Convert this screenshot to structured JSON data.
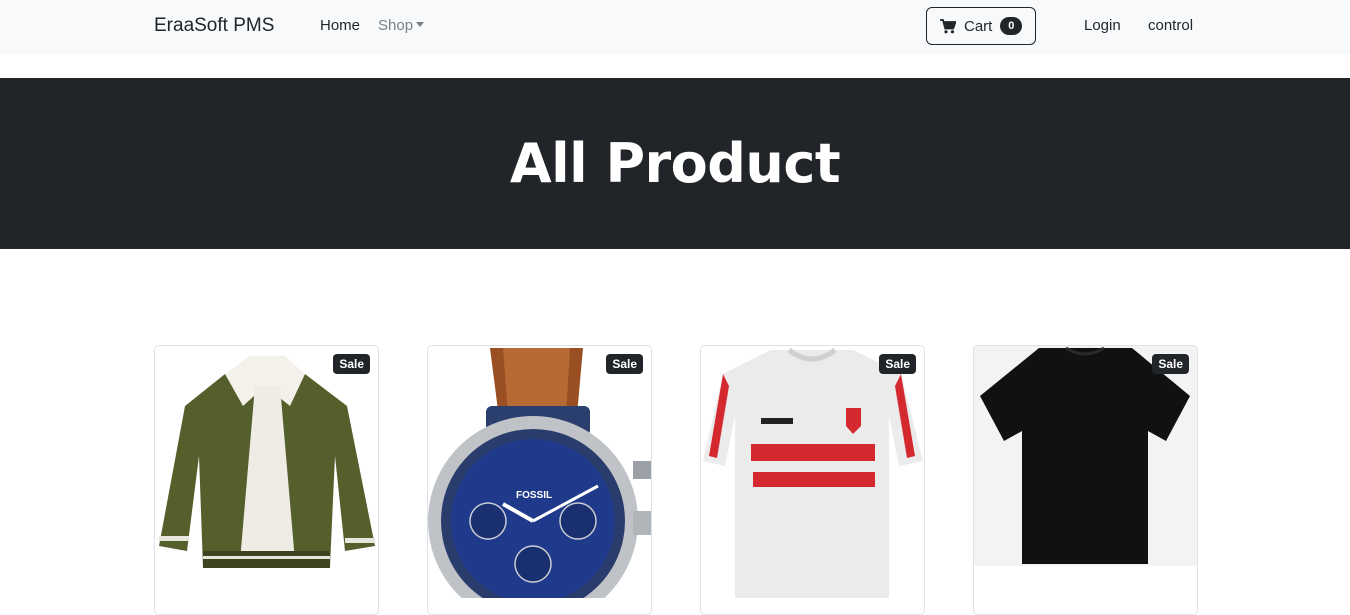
{
  "navbar": {
    "brand": "EraaSoft PMS",
    "home": "Home",
    "shop": "Shop",
    "cart_label": "Cart",
    "cart_count": "0",
    "login": "Login",
    "control": "control"
  },
  "hero": {
    "title": "All Product"
  },
  "products": [
    {
      "badge": "Sale",
      "image": "green-jacket"
    },
    {
      "badge": "Sale",
      "image": "blue-wristwatch"
    },
    {
      "badge": "Sale",
      "image": "white-red-football-jersey"
    },
    {
      "badge": "Sale",
      "image": "black-tshirt"
    }
  ],
  "colors": {
    "dark": "#212529",
    "navbar_bg": "#f8f9fa"
  }
}
